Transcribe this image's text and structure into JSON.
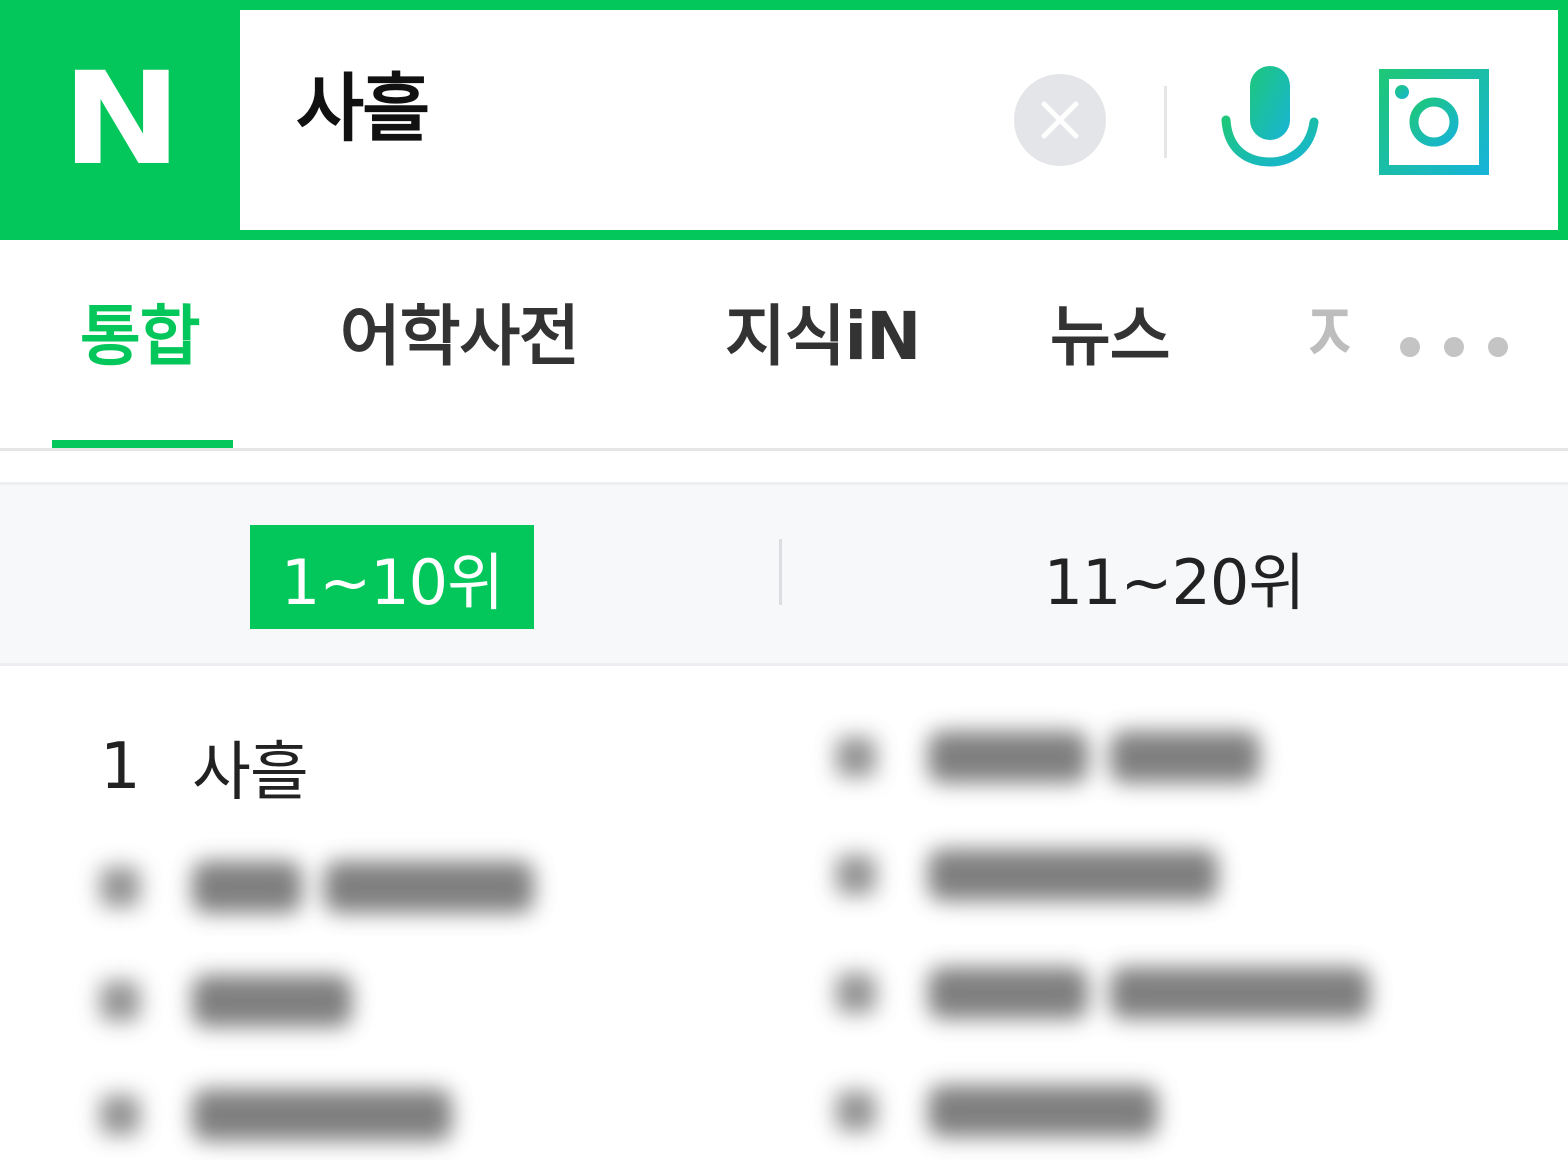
{
  "header": {
    "logo_letter": "N",
    "search": {
      "query": "사흘"
    },
    "icons": {
      "clear": "close-icon",
      "voice": "microphone-icon",
      "lens": "camera-lens-icon"
    },
    "colors": {
      "brand": "#03c75a",
      "voice_gradient_start": "#1ec77a",
      "voice_gradient_end": "#17b4d6"
    }
  },
  "tabs": {
    "items": [
      {
        "label": "통합",
        "active": true
      },
      {
        "label": "어학사전",
        "active": false
      },
      {
        "label": "지식iN",
        "active": false
      },
      {
        "label": "뉴스",
        "active": false
      },
      {
        "label": "지",
        "active": false
      }
    ],
    "more_icon": "more-horizontal-icon"
  },
  "ranking": {
    "toggle": [
      {
        "label": "1~10위",
        "active": true
      },
      {
        "label": "11~20위",
        "active": false
      }
    ],
    "items": [
      {
        "rank": "1",
        "term": "사흘"
      }
    ]
  }
}
